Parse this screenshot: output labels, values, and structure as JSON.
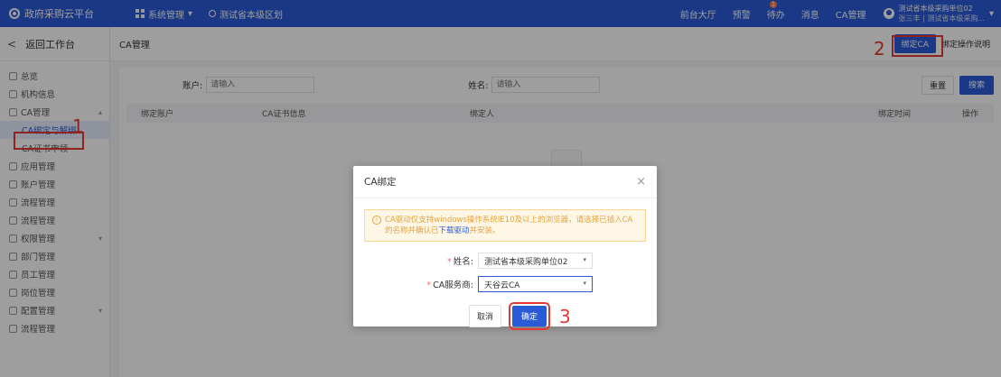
{
  "topbar": {
    "app_title": "政府采购云平台",
    "system_menu": "系统管理",
    "region": "测试省本级区划",
    "links": [
      "前台大厅",
      "预警",
      "待办",
      "消息",
      "CA管理"
    ],
    "todo_badge": "1",
    "user_name": "测试省本级采购单位02",
    "user_sub": "张三丰 | 测试省本级采购..."
  },
  "sidebar": {
    "back": "返回工作台",
    "items": [
      {
        "label": "总览"
      },
      {
        "label": "机构信息"
      },
      {
        "label": "CA管理"
      },
      {
        "label": "CA绑定与解绑"
      },
      {
        "label": "CA证书申领"
      },
      {
        "label": "应用管理"
      },
      {
        "label": "账户管理"
      },
      {
        "label": "流程管理"
      },
      {
        "label": "流程管理"
      },
      {
        "label": "权限管理"
      },
      {
        "label": "部门管理"
      },
      {
        "label": "员工管理"
      },
      {
        "label": "岗位管理"
      },
      {
        "label": "配置管理"
      },
      {
        "label": "流程管理"
      }
    ]
  },
  "page": {
    "title": "CA管理",
    "bind_button": "绑定CA",
    "help_link": "绑定操作说明"
  },
  "search": {
    "account_label": "账户:",
    "account_placeholder": "请输入",
    "name_label": "姓名:",
    "name_placeholder": "请输入",
    "reset": "重置",
    "search": "搜索"
  },
  "table": {
    "columns": [
      "绑定账户",
      "CA证书信息",
      "绑定人",
      "绑定时间",
      "操作"
    ]
  },
  "dialog": {
    "title": "CA绑定",
    "warning": "CA驱动仅支持windows操作系统IE10及以上的浏览器，请选择已插入CA的名称并确认已",
    "warning_link": "下载驱动",
    "warning_tail": "并安装。",
    "name_label": "姓名:",
    "name_value": "测试省本级采购单位02",
    "provider_label": "CA服务商:",
    "provider_value": "天谷云CA",
    "cancel": "取消",
    "confirm": "确定"
  },
  "annotations": {
    "step1": "1",
    "step2": "2",
    "step3": "3",
    "highlight_color": "#e53935"
  },
  "colors": {
    "primary": "#2a5bd7",
    "warning": "#e6a23c"
  }
}
